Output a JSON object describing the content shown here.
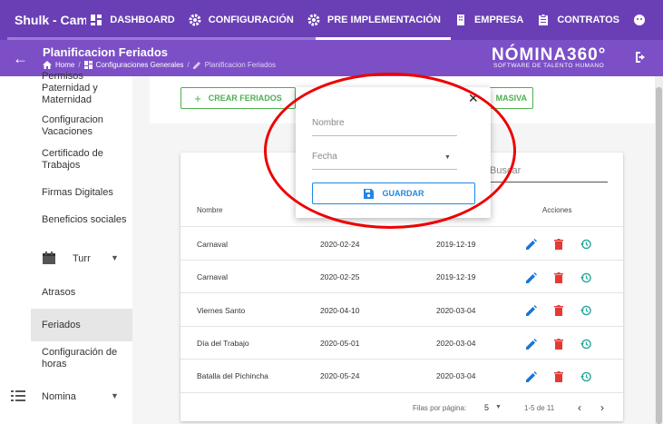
{
  "app": {
    "title": "Shulk - Camisas El"
  },
  "nav": [
    {
      "label": "DASHBOARD",
      "icon": "dashboard-icon"
    },
    {
      "label": "CONFIGURACIÓN",
      "icon": "gear-icon"
    },
    {
      "label": "PRE IMPLEMENTACIÓN",
      "icon": "gear-icon"
    },
    {
      "label": "EMPRESA",
      "icon": "building-icon"
    },
    {
      "label": "CONTRATOS",
      "icon": "contract-icon"
    }
  ],
  "header": {
    "title": "Planificacion Feriados",
    "breadcrumbs": [
      "Home",
      "Configuraciones Generales",
      "Planificacion Feriados"
    ],
    "logo": "NÓMINA360°",
    "logo_sub": "SOFTWARE DE TALENTO HUMANO"
  },
  "sidebar": {
    "items": [
      {
        "label": "Permisos Paternidad y Maternidad"
      },
      {
        "label": "Configuracion Vacaciones"
      },
      {
        "label": "Certificado de Trabajos"
      },
      {
        "label": "Firmas Digitales"
      },
      {
        "label": "Beneficios sociales"
      },
      {
        "label": "Turr"
      },
      {
        "label": "Atrasos"
      },
      {
        "label": "Feriados"
      },
      {
        "label": "Configuración de horas"
      },
      {
        "label": "Nomina"
      }
    ]
  },
  "toolbar": {
    "create_label": "CREAR FERIADOS",
    "bulk_label": "MASIVA"
  },
  "table": {
    "search_placeholder": "Buscar",
    "headers": {
      "name": "Nombre",
      "actions": "Acciones"
    },
    "rows": [
      {
        "nombre": "Carnaval",
        "fecha": "2020-02-24",
        "creado": "2019-12-19"
      },
      {
        "nombre": "Carnaval",
        "fecha": "2020-02-25",
        "creado": "2019-12-19"
      },
      {
        "nombre": "Viernes Santo",
        "fecha": "2020-04-10",
        "creado": "2020-03-04"
      },
      {
        "nombre": "Día del Trabajo",
        "fecha": "2020-05-01",
        "creado": "2020-03-04"
      },
      {
        "nombre": "Batalla del Pichincha",
        "fecha": "2020-05-24",
        "creado": "2020-03-04"
      }
    ],
    "footer": {
      "rows_per_page_label": "Filas por página:",
      "rows_per_page": "5",
      "range": "1-5 de 11"
    }
  },
  "dialog": {
    "name_placeholder": "Nombre",
    "date_placeholder": "Fecha",
    "save_label": "GUARDAR"
  },
  "colors": {
    "primary": "#6a3fb5",
    "accent_green": "#4caf50",
    "edit_blue": "#1976d2",
    "delete_red": "#e53935",
    "history_teal": "#26a69a",
    "annotation": "#e00000"
  }
}
